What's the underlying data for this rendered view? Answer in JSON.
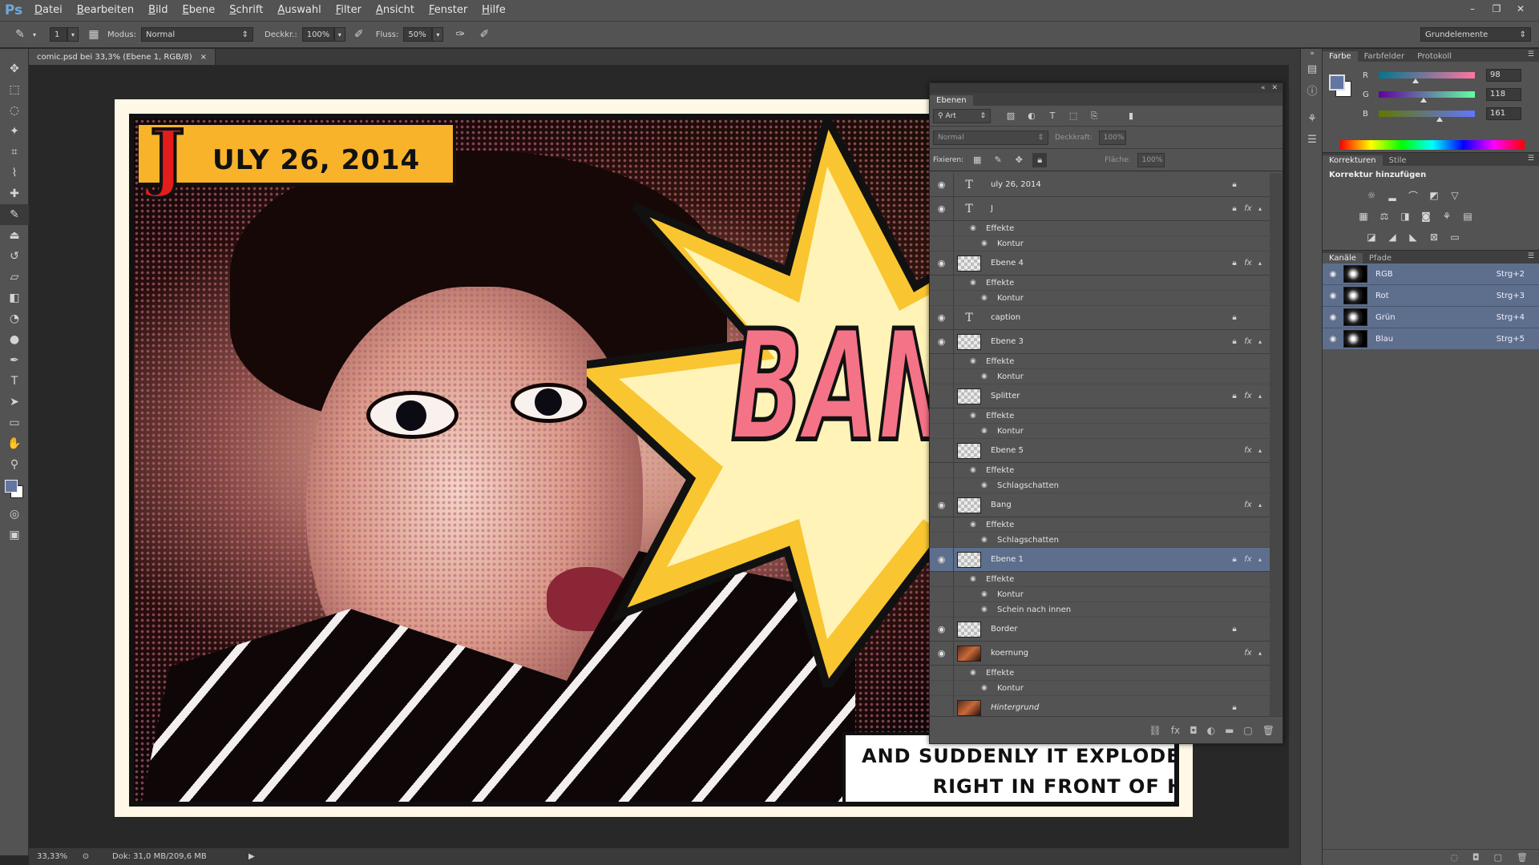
{
  "app": {
    "logo": "Ps"
  },
  "menu": [
    "Datei",
    "Bearbeiten",
    "Bild",
    "Ebene",
    "Schrift",
    "Auswahl",
    "Filter",
    "Ansicht",
    "Fenster",
    "Hilfe"
  ],
  "window_controls": {
    "minimize": "–",
    "restore": "❐",
    "close": "✕"
  },
  "options": {
    "brush_size": "1",
    "mode_label": "Modus:",
    "mode_value": "Normal",
    "opacity_label": "Deckkr.:",
    "opacity_value": "100%",
    "flow_label": "Fluss:",
    "flow_value": "50%",
    "workspace": "Grundelemente"
  },
  "document": {
    "tab_title": "comic.psd bei 33,3% (Ebene 1, RGB/8)",
    "tab_close": "×",
    "zoom": "33,33%",
    "doc_size": "Dok: 31,0 MB/209,6 MB"
  },
  "artwork": {
    "date_initial": "J",
    "date_rest": "ULY 26, 2014",
    "bang": "BANG",
    "caption_line1": "AND SUDDENLY IT EXPLODES",
    "caption_line2": "RIGHT IN FRONT OF HIS FACE!"
  },
  "layers_panel": {
    "tab": "Ebenen",
    "filter_kind": "Art",
    "blend_mode": "Normal",
    "opacity_label": "Deckkraft:",
    "opacity_value": "100%",
    "lock_label": "Fixieren:",
    "fill_label": "Fläche:",
    "fill_value": "100%",
    "layers": [
      {
        "name": "uly 26, 2014",
        "kind": "type",
        "visible": true,
        "locked": true,
        "fx": false,
        "effects": []
      },
      {
        "name": "J",
        "kind": "type",
        "visible": true,
        "locked": true,
        "fx": true,
        "effects": [
          "Kontur"
        ]
      },
      {
        "name": "Ebene 4",
        "kind": "pixel",
        "visible": true,
        "locked": true,
        "fx": true,
        "effects": [
          "Kontur"
        ]
      },
      {
        "name": "caption",
        "kind": "type",
        "visible": true,
        "locked": true,
        "fx": false,
        "effects": []
      },
      {
        "name": "Ebene 3",
        "kind": "pixel",
        "visible": true,
        "locked": true,
        "fx": true,
        "effects": [
          "Kontur"
        ]
      },
      {
        "name": "Splitter",
        "kind": "pixel",
        "visible": false,
        "locked": true,
        "fx": true,
        "effects": [
          "Kontur"
        ]
      },
      {
        "name": "Ebene 5",
        "kind": "pixel",
        "visible": false,
        "locked": false,
        "fx": true,
        "effects": [
          "Schlagschatten"
        ]
      },
      {
        "name": "Bang",
        "kind": "pixel",
        "visible": true,
        "locked": false,
        "fx": true,
        "effects": [
          "Schlagschatten"
        ]
      },
      {
        "name": "Ebene 1",
        "kind": "pixel",
        "visible": true,
        "locked": true,
        "fx": true,
        "selected": true,
        "effects": [
          "Kontur",
          "Schein nach innen"
        ]
      },
      {
        "name": "Border",
        "kind": "pixel",
        "visible": true,
        "locked": true,
        "fx": false,
        "effects": []
      },
      {
        "name": "koernung",
        "kind": "photo",
        "visible": true,
        "locked": false,
        "fx": true,
        "effects": [
          "Kontur"
        ]
      },
      {
        "name": "Hintergrund",
        "kind": "photo",
        "visible": false,
        "locked": true,
        "fx": false,
        "italic": true,
        "effects": []
      }
    ],
    "effects_label": "Effekte"
  },
  "color_panel": {
    "tabs": [
      "Farbe",
      "Farbfelder",
      "Protokoll"
    ],
    "r_label": "R",
    "r_value": "98",
    "g_label": "G",
    "g_value": "118",
    "b_label": "B",
    "b_value": "161",
    "fg_color": "#6276a1",
    "r_level": 0.384,
    "g_level": 0.463,
    "b_level": 0.631
  },
  "adjust_panel": {
    "tabs": [
      "Korrekturen",
      "Stile"
    ],
    "title": "Korrektur hinzufügen"
  },
  "channels_panel": {
    "tabs": [
      "Kanäle",
      "Pfade"
    ],
    "channels": [
      {
        "name": "RGB",
        "shortcut": "Strg+2"
      },
      {
        "name": "Rot",
        "shortcut": "Strg+3"
      },
      {
        "name": "Grün",
        "shortcut": "Strg+4"
      },
      {
        "name": "Blau",
        "shortcut": "Strg+5"
      }
    ]
  },
  "colors": {
    "selection": "#5d6f8d",
    "bang_fill": "#f47386",
    "banner": "#f8b32a",
    "burst_outer": "#f9c631",
    "burst_inner": "#fff3b8"
  }
}
